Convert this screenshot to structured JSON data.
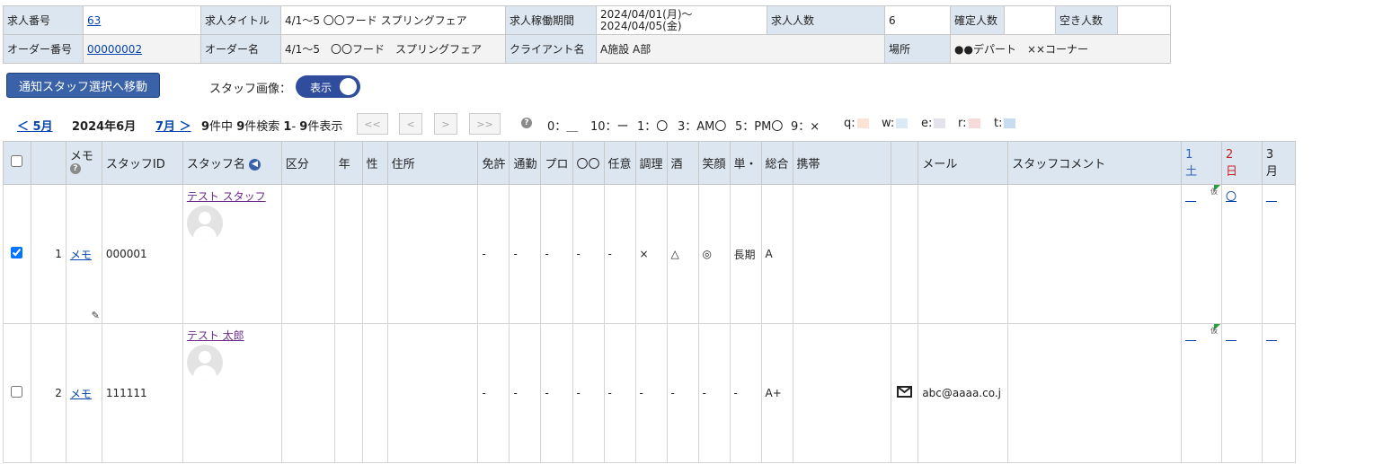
{
  "job": {
    "number_label": "求人番号",
    "number": "63",
    "title_label": "求人タイトル",
    "title": "4/1～5 〇〇フード スプリングフェア",
    "period_label": "求人稼働期間",
    "period_start": "2024/04/01(月)～",
    "period_end": "2024/04/05(金)",
    "count_label": "求人人数",
    "count": "6",
    "confirmed_label": "確定人数",
    "confirmed": "",
    "vacant_label": "空き人数",
    "vacant": "",
    "order_label": "オーダー番号",
    "order": "00000002",
    "order_name_label": "オーダー名",
    "order_name": "4/1～5　〇〇フード　スプリングフェア",
    "client_label": "クライアント名",
    "client": "A施設 A部",
    "place_label": "場所",
    "place": "●●デパート　××コーナー"
  },
  "controls": {
    "move_button": "通知スタッフ選択へ移動",
    "image_label": "スタッフ画像：",
    "image_toggle": "表示",
    "image_toggle_on": true
  },
  "pager": {
    "prev": "＜ 5月",
    "current": "2024年6月",
    "next": "7月 ＞",
    "total": "9",
    "total_suffix": "件中",
    "found": "9",
    "found_suffix": "件検索",
    "range_start": "1",
    "range_sep": "- ",
    "range_end": "9",
    "range_suffix": "件表示",
    "first": "<<",
    "back": "<",
    "forward": ">",
    "last": ">>"
  },
  "legend": {
    "items": [
      "0：＿",
      "10：ー",
      "1：〇",
      "3：AM〇",
      "5：PM〇",
      "9：×"
    ],
    "swatches": [
      {
        "label": "q:",
        "color": "#fbe3d6"
      },
      {
        "label": "w:",
        "color": "#dbeaf5"
      },
      {
        "label": "e:",
        "color": "#e4e2ec"
      },
      {
        "label": "r:",
        "color": "#f6dada"
      },
      {
        "label": "t:",
        "color": "#c9dbef"
      }
    ]
  },
  "columns": {
    "memo": "メモ",
    "staff_id": "スタッフID",
    "staff_name": "スタッフ名",
    "category": "区分",
    "age": "年",
    "sex": "性",
    "address": "住所",
    "license": "免許",
    "commute": "通勤",
    "pro": "プロ",
    "oo": "〇〇",
    "optional": "任意",
    "cooking": "調理",
    "alcohol": "酒",
    "smile": "笑顔",
    "single": "単・",
    "overall": "総合",
    "mobile": "携帯",
    "mail": "メール",
    "comment": "スタッフコメント",
    "days": [
      {
        "num": "1",
        "dow": "土",
        "color": "#2f62b8"
      },
      {
        "num": "2",
        "dow": "日",
        "color": "#cc2222"
      },
      {
        "num": "3",
        "dow": "月",
        "color": "#222222"
      }
    ]
  },
  "staff": [
    {
      "checked": true,
      "no": "1",
      "memo": "メモ",
      "id": "000001",
      "name": "テスト スタッフ",
      "license": "-",
      "commute": "-",
      "pro": "-",
      "oo": "-",
      "optional": "-",
      "cooking": "×",
      "alcohol": "△",
      "smile": "◎",
      "single": "長期",
      "overall": "A",
      "mail": "",
      "day1": "＿",
      "day2": "〇",
      "day3": "＿",
      "mark": "仮"
    },
    {
      "checked": false,
      "no": "2",
      "memo": "メモ",
      "id": "111111",
      "name": "テスト 太郎",
      "license": "-",
      "commute": "-",
      "pro": "-",
      "oo": "-",
      "optional": "-",
      "cooking": "-",
      "alcohol": "-",
      "smile": "-",
      "single": "-",
      "overall": "A+",
      "mail": "abc@aaaa.co.j",
      "day1": "＿",
      "day2": "＿",
      "day3": "＿",
      "mark": "仮"
    }
  ]
}
